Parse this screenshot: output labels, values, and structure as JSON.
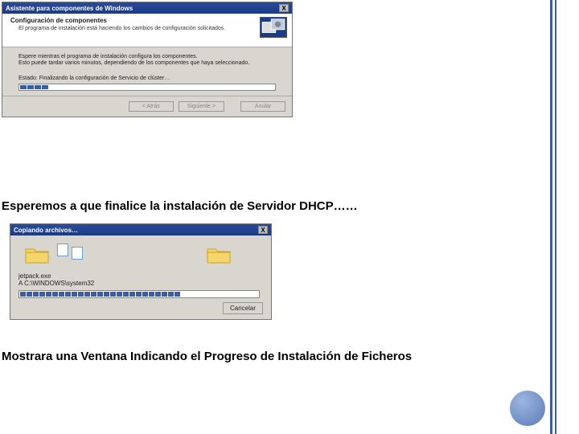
{
  "win1": {
    "title": "Asistente para componentes de Windows",
    "close": "X",
    "header_title": "Configuración de componentes",
    "header_sub": "El programa de instalación está haciendo los cambios de configuración solicitados.",
    "body_line1": "Espere mientras el programa de instalación configura los componentes.",
    "body_line2": "Esto puede tardar varios minutos, dependiendo de los componentes que haya seleccionado.",
    "estado_label": "Estado:",
    "estado_text": "Finalizando la configuración de Servicio de clúster…",
    "btn_back": "< Atrás",
    "btn_next": "Siguiente >",
    "btn_cancel": "Anular"
  },
  "caption1": "Esperemos a que finalice la instalación de Servidor DHCP……",
  "win2": {
    "title": "Copiando archivos…",
    "close": "X",
    "filename": "jetpack.exe",
    "path": "A C:\\WINDOWS\\system32",
    "btn_cancel": "Cancelar"
  },
  "caption2": "Mostrara una Ventana Indicando el Progreso de Instalación de Ficheros",
  "colors": {
    "accent": "#3a5da8"
  }
}
